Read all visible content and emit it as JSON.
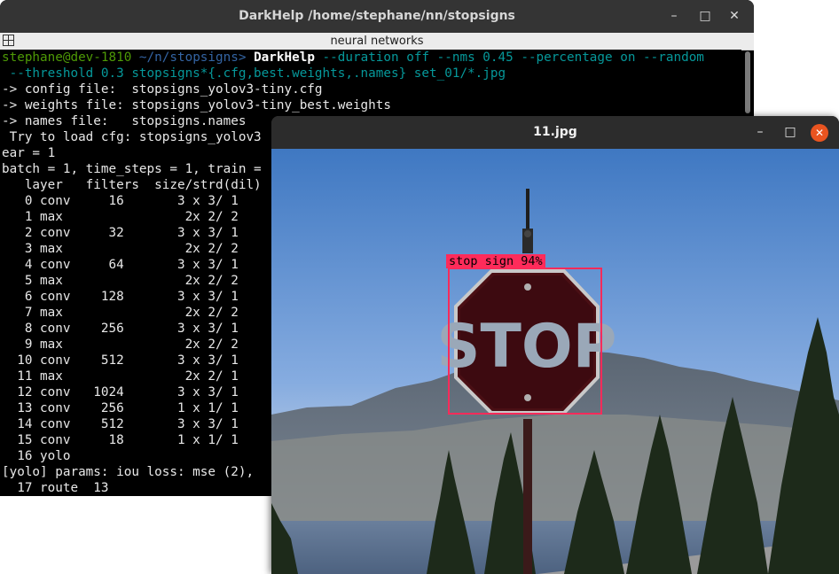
{
  "terminal": {
    "title": "DarkHelp  /home/stephane/nn/stopsigns",
    "tab_label": "neural networks",
    "buttons": {
      "minimize": "–",
      "maximize": "□",
      "close": "✕"
    },
    "prompt": {
      "user": "stephane@dev-1810",
      "path": " ~/n/stopsigns> "
    },
    "command": "DarkHelp",
    "args_line1": " --duration off --nms 0.45 --percentage on --random",
    "args_line2": " --threshold 0.3 stopsigns*{.cfg,best.weights,.names} set_01/*.jpg",
    "output_lines": [
      "-> config file:  stopsigns_yolov3-tiny.cfg",
      "-> weights file: stopsigns_yolov3-tiny_best.weights",
      "-> names file:   stopsigns.names",
      " Try to load cfg: stopsigns_yolov3",
      "ear = 1",
      "batch = 1, time_steps = 1, train =",
      "   layer   filters  size/strd(dil)",
      "   0 conv     16       3 x 3/ 1",
      "   1 max                2x 2/ 2",
      "   2 conv     32       3 x 3/ 1",
      "   3 max                2x 2/ 2",
      "   4 conv     64       3 x 3/ 1",
      "   5 max                2x 2/ 2",
      "   6 conv    128       3 x 3/ 1",
      "   7 max                2x 2/ 2",
      "   8 conv    256       3 x 3/ 1",
      "   9 max                2x 2/ 2",
      "  10 conv    512       3 x 3/ 1",
      "  11 max                2x 2/ 1",
      "  12 conv   1024       3 x 3/ 1",
      "  13 conv    256       1 x 1/ 1",
      "  14 conv    512       3 x 3/ 1",
      "  15 conv     18       1 x 1/ 1",
      "  16 yolo",
      "[yolo] params: iou loss: mse (2),",
      "  17 route  13"
    ]
  },
  "viewer": {
    "title": "11.jpg",
    "buttons": {
      "minimize": "–",
      "maximize": "□",
      "close": "✕"
    },
    "detection": {
      "label": "stop sign 94%",
      "box_color": "#ff2b5a"
    },
    "sign_text": "STOP"
  }
}
